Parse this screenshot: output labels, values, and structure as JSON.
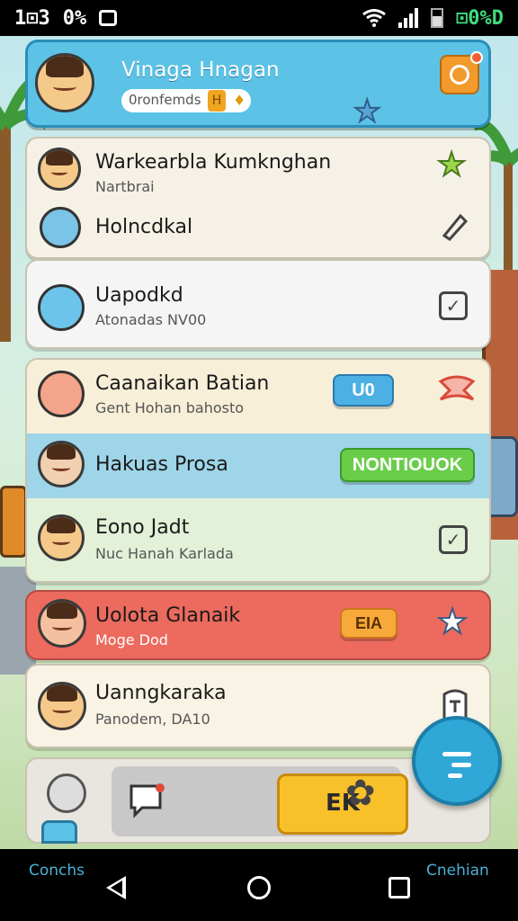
{
  "status_bar": {
    "time": "1⊡3",
    "left_extra": "0%",
    "battery_text": "⊡0%D",
    "icons": [
      "wifi-icon",
      "signal-icon",
      "battery-icon"
    ]
  },
  "header": {
    "title": "Vinaga Hnagan",
    "pill_text": "0ronfemds",
    "badge": "H",
    "icons": [
      "avatar",
      "star-icon",
      "notification-icon"
    ]
  },
  "list": [
    {
      "title": "Warkearbla Kumkn‍ghan",
      "subtitle": "Nartbrai",
      "action_icon": "star-icon",
      "bg": "#f6f1e6"
    },
    {
      "title": "Holncdkal",
      "subtitle": "",
      "action_icon": "pencil-icon",
      "bg": "#f6f1e6"
    },
    {
      "title": "Uapodkd",
      "subtitle": "Atonadas NV00",
      "action_icon": "check-box-icon",
      "bg": "#f5f5f5"
    },
    {
      "title": "Caanaikan Batian",
      "subtitle": "Gent Hohan bahosto",
      "button": "U0",
      "action_icon": "ribbon-icon",
      "bg": "#f8efd9"
    },
    {
      "title": "Hakuas Prosa",
      "subtitle": "",
      "button": "NONTIOUOK",
      "bg": "#9fd5e8"
    },
    {
      "title": "Eono Jadt",
      "subtitle": "Nuc Hanah Karlada",
      "action_icon": "check-box-icon",
      "bg": "#e3f1d8"
    },
    {
      "title": "Uolota Glanaik",
      "subtitle": "Moge Dod",
      "button": "EIA",
      "action_icon": "star-icon",
      "bg": "#ec6a5e"
    },
    {
      "title": "Uanngkaraka",
      "subtitle": "Panodem, DA10",
      "action_icon": "bookmark-icon",
      "bg": "#f8f3e4"
    }
  ],
  "toolbar": {
    "main_label": "EK",
    "icons": [
      "globe-icon",
      "chat-icon",
      "settings-icon",
      "document-icon"
    ]
  },
  "nav": {
    "left_label": "Conchs",
    "right_label": "Cnehian"
  },
  "colors": {
    "accent": "#5cc3e6",
    "primary_button": "#f8c12a",
    "success": "#5cc84a",
    "danger": "#ec6a5e"
  }
}
